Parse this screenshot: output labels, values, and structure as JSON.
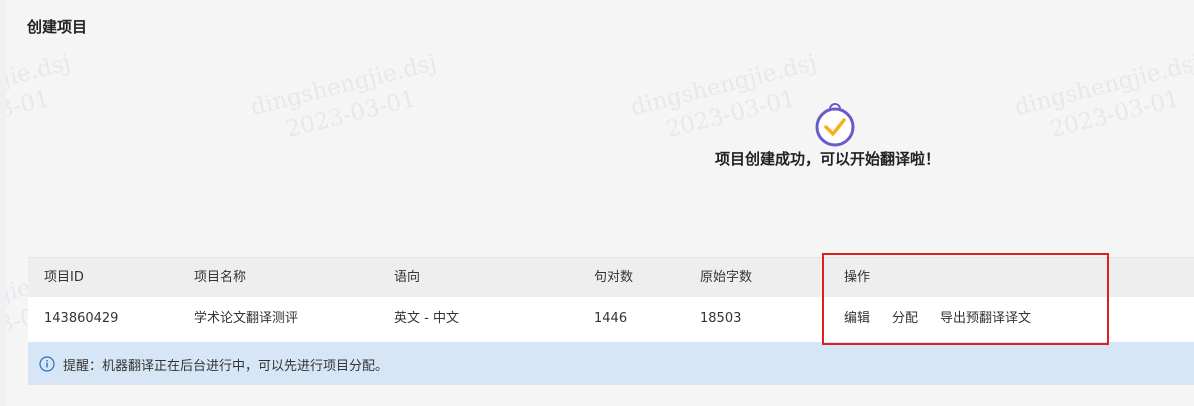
{
  "page": {
    "title": "创建项目"
  },
  "success": {
    "message": "项目创建成功，可以开始翻译啦！"
  },
  "table": {
    "headers": {
      "id": "项目ID",
      "name": "项目名称",
      "direction": "语向",
      "sentences": "句对数",
      "chars": "原始字数",
      "actions": "操作"
    },
    "row": {
      "id": "143860429",
      "name": "学术论文翻译测评",
      "direction": "英文 - 中文",
      "sentences": "1446",
      "chars": "18503",
      "actions": {
        "edit": "编辑",
        "assign": "分配",
        "export": "导出预翻译译文"
      }
    }
  },
  "tip": {
    "icon": "info-icon",
    "text": "提醒：机器翻译正在后台进行中，可以先进行项目分配。"
  },
  "watermark": {
    "line1": "dingshengjie.dsj",
    "line2": "2023-03-01"
  },
  "colors": {
    "link": "#2f6fc0",
    "accent": "#6a5acd",
    "check": "#f5b21c",
    "highlight": "#e0201f",
    "tip_bg": "#d6e6f6"
  }
}
